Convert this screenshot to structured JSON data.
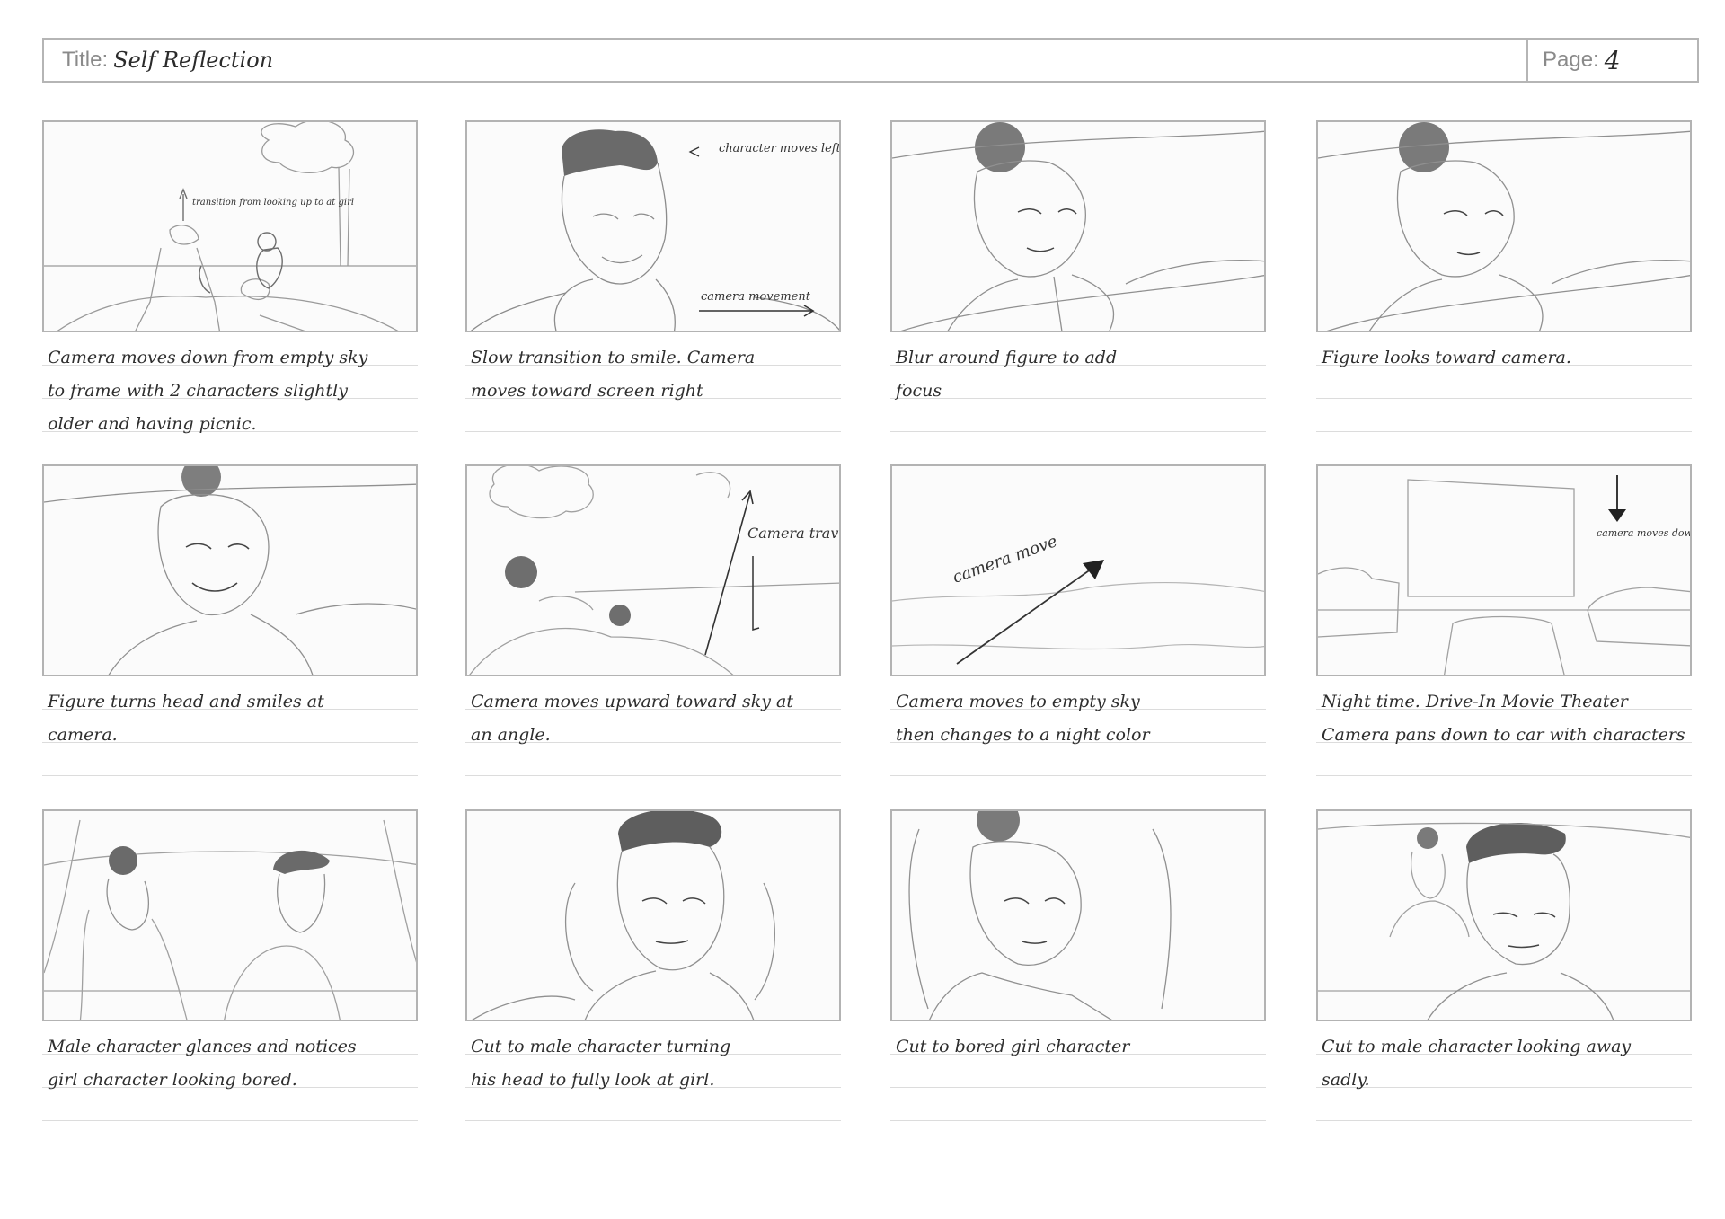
{
  "header": {
    "title_label": "Title:",
    "title_value": "Self Reflection",
    "page_label": "Page:",
    "page_value": "4"
  },
  "panels": [
    {
      "caption": "Camera moves down from empty sky\nto frame with 2 characters slightly\nolder and having picnic.",
      "note": "transition from looking up to at girl"
    },
    {
      "caption": "Slow transition to smile. Camera\nmoves toward screen right",
      "note": "character moves left from camera right",
      "note2": "camera movement"
    },
    {
      "caption": "Blur around figure to add\nfocus"
    },
    {
      "caption": "Figure looks toward camera."
    },
    {
      "caption": "Figure turns head and smiles at\ncamera."
    },
    {
      "caption": "Camera moves upward toward sky at\nan angle.",
      "note": "Camera travels up"
    },
    {
      "caption": "Camera moves to empty sky\nthen changes to a night color",
      "note": "camera move"
    },
    {
      "caption": "Night time. Drive-In Movie Theater\nCamera pans down to car with characters",
      "note": "camera moves down from dark sky"
    },
    {
      "caption": "Male character glances and notices\ngirl character looking bored."
    },
    {
      "caption": "Cut to male character turning\nhis head to fully look at girl."
    },
    {
      "caption": "Cut to bored girl character"
    },
    {
      "caption": "Cut to male character looking away\nsadly."
    }
  ]
}
